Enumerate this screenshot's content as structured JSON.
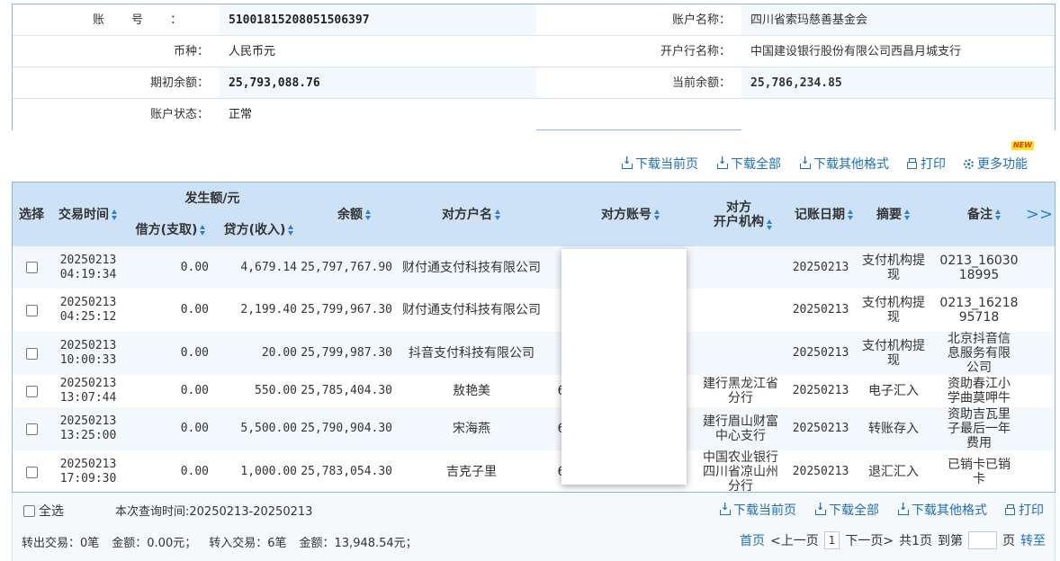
{
  "account_info": {
    "account_no_label": "账号：",
    "account_no": "51001815208051506397",
    "account_name_label": "账户名称：",
    "account_name": "四川省索玛慈善基金会",
    "currency_label": "币种：",
    "currency": "人民币元",
    "bank_label": "开户行名称：",
    "bank": "中国建设银行股份有限公司西昌月城支行",
    "opening_balance_label": "期初余额：",
    "opening_balance": "25,793,088.76",
    "current_balance_label": "当前余额：",
    "current_balance": "25,786,234.85",
    "status_label": "账户状态：",
    "status": "正常"
  },
  "toolbar": {
    "download_current": "下载当前页",
    "download_all": "下载全部",
    "download_other": "下载其他格式",
    "print": "打印",
    "more": "更多功能",
    "new_badge": "NEW"
  },
  "table": {
    "headers": {
      "select": "选择",
      "time": "交易时间",
      "amount_group": "发生额/元",
      "debit": "借方(支取)",
      "credit": "贷方(收入)",
      "balance": "余额",
      "counterparty_name": "对方户名",
      "counterparty_account": "对方账号",
      "counterparty_bank": "对方\n开户机构",
      "post_date": "记账日期",
      "summary": "摘要",
      "remark": "备注",
      "more": ">>"
    },
    "rows": [
      {
        "date": "20250213",
        "time": "04:19:34",
        "debit": "0.00",
        "credit": "4,679.14",
        "balance": "25,797,767.90",
        "name": "财付通支付科技有限公司",
        "account": "",
        "bank": "",
        "post_date": "20250213",
        "summary": "支付机构提现",
        "remark": "0213_16030 18995"
      },
      {
        "date": "20250213",
        "time": "04:25:12",
        "debit": "0.00",
        "credit": "2,199.40",
        "balance": "25,799,967.30",
        "name": "财付通支付科技有限公司",
        "account": "",
        "bank": "",
        "post_date": "20250213",
        "summary": "支付机构提现",
        "remark": "0213_16218 95718"
      },
      {
        "date": "20250213",
        "time": "10:00:33",
        "debit": "0.00",
        "credit": "20.00",
        "balance": "25,799,987.30",
        "name": "抖音支付科技有限公司",
        "account": "",
        "bank": "",
        "post_date": "20250213",
        "summary": "支付机构提现",
        "remark": "北京抖音信息服务有限公司"
      },
      {
        "date": "20250213",
        "time": "13:07:44",
        "debit": "0.00",
        "credit": "550.00",
        "balance": "25,785,404.30",
        "name": "敖艳美",
        "account": "6",
        "bank": "建行黑龙江省分行",
        "post_date": "20250213",
        "summary": "电子汇入",
        "remark": "资助春江小学曲莫呷牛"
      },
      {
        "date": "20250213",
        "time": "13:25:00",
        "debit": "0.00",
        "credit": "5,500.00",
        "balance": "25,790,904.30",
        "name": "宋海燕",
        "account": "6",
        "bank": "建行眉山财富中心支行",
        "post_date": "20250213",
        "summary": "转账存入",
        "remark": "资助吉瓦里子最后一年费用"
      },
      {
        "date": "20250213",
        "time": "17:09:30",
        "debit": "0.00",
        "credit": "1,000.00",
        "balance": "25,783,054.30",
        "name": "吉克子里",
        "account": "6",
        "bank": "中国农业银行四川省凉山州分行",
        "post_date": "20250213",
        "summary": "退汇汇入",
        "remark": "已销卡已销卡"
      }
    ]
  },
  "footer": {
    "select_all": "全选",
    "query_time": "本次查询时间:20250213-20250213",
    "out_count_label": "转出交易：0笔",
    "out_amount_label": "金额：0.00元；",
    "in_count_label": "转入交易：6笔",
    "in_amount_label": "金额：13,948.54元；",
    "pager": {
      "first": "首页",
      "prev": "<上一页",
      "current": "1",
      "next": "下一页>",
      "total": "共1页",
      "goto_label": "到第",
      "page_suffix": "页",
      "goto": "转至"
    }
  }
}
